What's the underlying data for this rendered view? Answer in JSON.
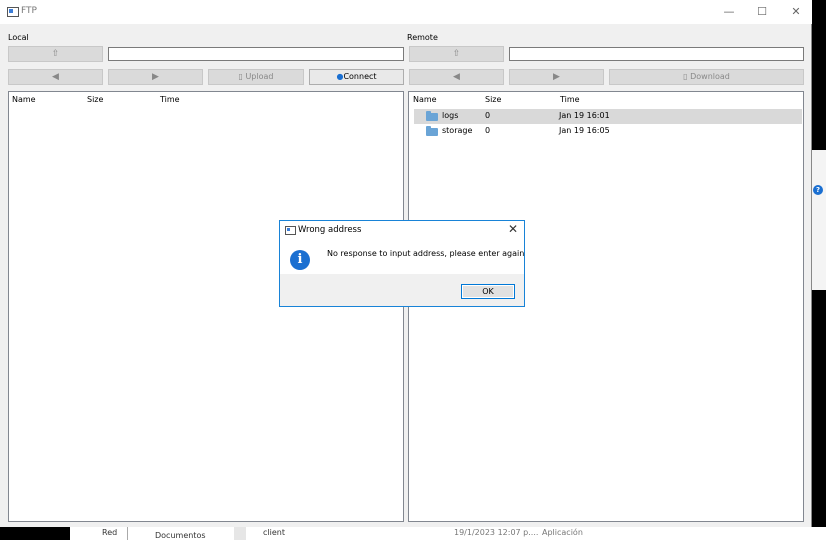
{
  "window": {
    "title": "FTP",
    "controls": {
      "minimize": "—",
      "maximize": "☐",
      "close": "✕"
    }
  },
  "local": {
    "label": "Local",
    "buttons": {
      "back": "◀",
      "forward": "▶",
      "upload": "Upload",
      "connect": "Connect",
      "up": "⇧"
    },
    "columns": {
      "name": "Name",
      "size": "Size",
      "time": "Time"
    }
  },
  "remote": {
    "label": "Remote",
    "buttons": {
      "back": "◀",
      "forward": "▶",
      "download": "Download",
      "up": "⇧"
    },
    "columns": {
      "name": "Name",
      "size": "Size",
      "time": "Time"
    },
    "rows": [
      {
        "name": "logs",
        "size": "0",
        "time": "Jan 19 16:01"
      },
      {
        "name": "storage",
        "size": "0",
        "time": "Jan 19 16:05"
      }
    ]
  },
  "dialog": {
    "title": "Wrong address",
    "message": "No response to input address, please enter again",
    "ok_label": "OK",
    "close": "✕",
    "info_glyph": "i"
  },
  "background": {
    "item_red": "Red",
    "item_documents": "Documentos",
    "item_client": "client",
    "item_date": "19/1/2023 12:07 p....",
    "item_type": "Aplicación",
    "badge": "?"
  },
  "colors": {
    "accent": "#1883d7",
    "info": "#1a6fd1",
    "folder": "#6aa4d6",
    "selection": "#d9d9d9"
  }
}
